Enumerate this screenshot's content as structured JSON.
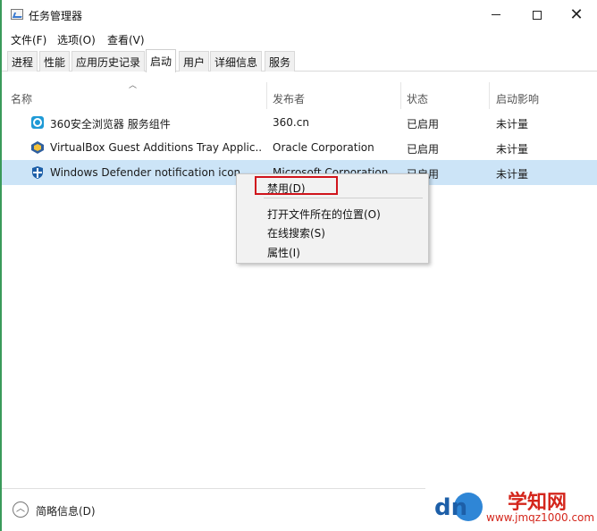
{
  "window": {
    "title": "任务管理器"
  },
  "menubar": [
    {
      "label": "文件(F)"
    },
    {
      "label": "选项(O)"
    },
    {
      "label": "查看(V)"
    }
  ],
  "tabs": [
    {
      "label": "进程",
      "active": false
    },
    {
      "label": "性能",
      "active": false
    },
    {
      "label": "应用历史记录",
      "active": false
    },
    {
      "label": "启动",
      "active": true
    },
    {
      "label": "用户",
      "active": false
    },
    {
      "label": "详细信息",
      "active": false
    },
    {
      "label": "服务",
      "active": false
    }
  ],
  "columns": [
    {
      "label": "名称"
    },
    {
      "label": "发布者"
    },
    {
      "label": "状态"
    },
    {
      "label": "启动影响"
    }
  ],
  "rows": [
    {
      "icon": "360-browser-icon",
      "name": "360安全浏览器 服务组件",
      "publisher": "360.cn",
      "status": "已启用",
      "impact": "未计量",
      "selected": false
    },
    {
      "icon": "virtualbox-icon",
      "name": "VirtualBox Guest Additions Tray Applic...",
      "publisher": "Oracle Corporation",
      "status": "已启用",
      "impact": "未计量",
      "selected": false
    },
    {
      "icon": "windows-defender-icon",
      "name": "Windows Defender notification icon",
      "publisher": "Microsoft Corporation",
      "status": "已启用",
      "impact": "未计量",
      "selected": true
    }
  ],
  "context_menu": {
    "items": [
      {
        "label": "禁用(D)",
        "highlighted": true
      },
      {
        "label": "打开文件所在的位置(O)"
      },
      {
        "label": "在线搜索(S)"
      },
      {
        "label": "属性(I)"
      }
    ],
    "highlight_color": "#d0141c"
  },
  "footer": {
    "label": "简略信息(D)"
  },
  "watermark": {
    "title": "学知网",
    "url": "www.jmqz1000.com",
    "color": "#d4261c"
  },
  "colors": {
    "selected_row": "#cce4f7",
    "accent": "#2a8a4a"
  }
}
